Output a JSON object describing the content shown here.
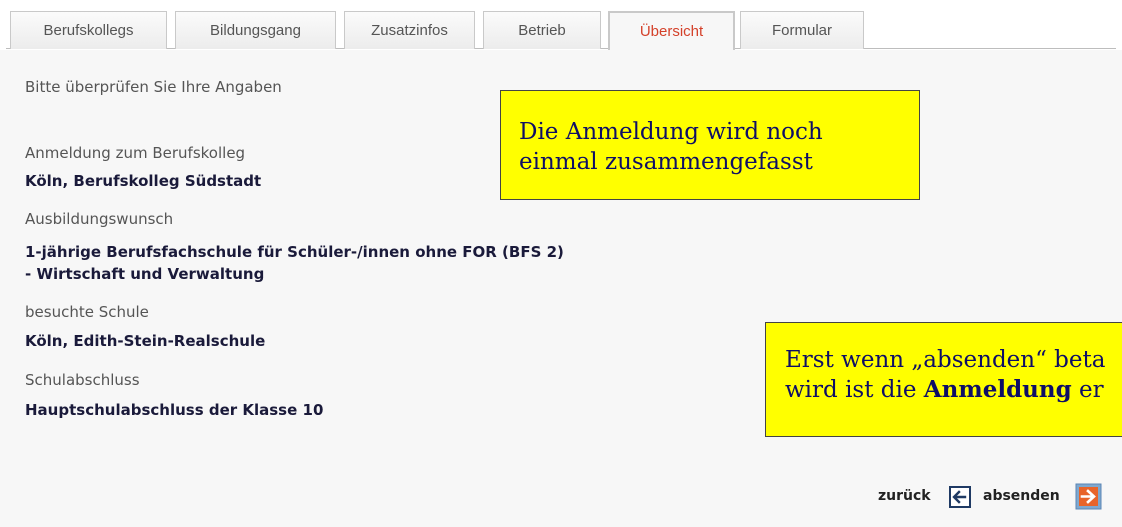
{
  "tabs": [
    {
      "label": "Berufskollegs",
      "active": false
    },
    {
      "label": "Bildungsgang",
      "active": false
    },
    {
      "label": "Zusatzinfos",
      "active": false
    },
    {
      "label": "Betrieb",
      "active": false
    },
    {
      "label": "Übersicht",
      "active": true
    },
    {
      "label": "Formular",
      "active": false
    }
  ],
  "colors": {
    "active_tab_text": "#d4412a",
    "callout_background": "#ffff00",
    "callout_text": "#0e0e66",
    "next_icon": "#e8642a"
  },
  "intro": "Bitte überprüfen Sie Ihre Angaben",
  "summary": {
    "berufskolleg": {
      "label": "Anmeldung zum Berufskolleg",
      "value": "Köln, Berufskolleg Südstadt"
    },
    "ausbildung": {
      "label": "Ausbildungswunsch",
      "value_line1": "1-jährige Berufsfachschule für Schüler-/innen ohne FOR (BFS 2)",
      "value_line2": "- Wirtschaft und Verwaltung"
    },
    "schule": {
      "label": "besuchte Schule",
      "value": "Köln, Edith-Stein-Realschule"
    },
    "abschluss": {
      "label": "Schulabschluss",
      "value": "Hauptschulabschluss der Klasse 10"
    }
  },
  "callout_top": {
    "line1": "Die Anmeldung wird noch",
    "line2": "einmal zusammengefasst"
  },
  "callout_bottom": {
    "line1": "Erst wenn „absenden“ beta",
    "line2_pre": "wird ist die ",
    "line2_bold": "Anmeldung",
    "line2_post": " er"
  },
  "nav": {
    "back_label": "zurück",
    "back_icon": "arrow-left-icon",
    "submit_label": "absenden",
    "submit_icon": "arrow-right-icon"
  }
}
